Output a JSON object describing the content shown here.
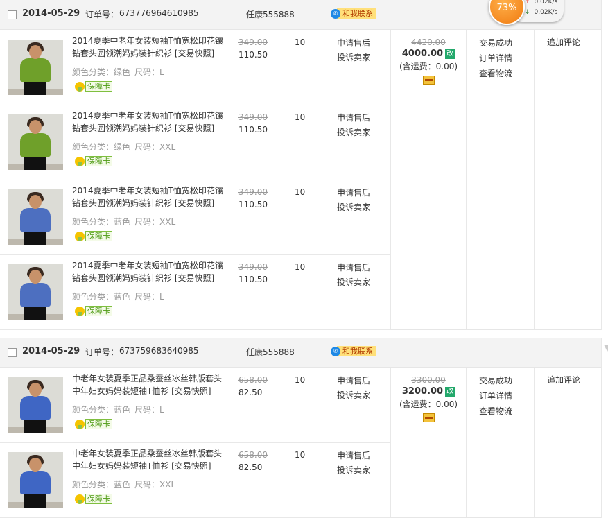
{
  "speed": {
    "percent": "73%",
    "up": "0.02K/s",
    "down": "0.02K/s"
  },
  "orders": [
    {
      "date": "2014-05-29",
      "order_label": "订单号：",
      "order_no": "673776964610985",
      "seller": "任康555888",
      "contact": "和我联系",
      "total_old": "4420.00",
      "total": "4000.00",
      "edit": "改",
      "shipping": "(含运费：0.00)",
      "status": [
        "交易成功",
        "订单详情",
        "查看物流"
      ],
      "review": "追加评论",
      "items": [
        {
          "title": "2014夏季中老年女装短袖T恤宽松印花镶钻套头圆领潮妈妈装针织衫 [交易快照]",
          "attr_color": "颜色分类：绿色",
          "attr_size": "尺码：L",
          "badge": "保障卡",
          "old_price": "349.00",
          "price": "110.50",
          "qty": "10",
          "action1": "申请售后",
          "action2": "投诉卖家",
          "shirt": "#6fa02a"
        },
        {
          "title": "2014夏季中老年女装短袖T恤宽松印花镶钻套头圆领潮妈妈装针织衫 [交易快照]",
          "attr_color": "颜色分类：绿色",
          "attr_size": "尺码：XXL",
          "badge": "保障卡",
          "old_price": "349.00",
          "price": "110.50",
          "qty": "10",
          "action1": "申请售后",
          "action2": "投诉卖家",
          "shirt": "#6fa02a"
        },
        {
          "title": "2014夏季中老年女装短袖T恤宽松印花镶钻套头圆领潮妈妈装针织衫 [交易快照]",
          "attr_color": "颜色分类：蓝色",
          "attr_size": "尺码：XXL",
          "badge": "保障卡",
          "old_price": "349.00",
          "price": "110.50",
          "qty": "10",
          "action1": "申请售后",
          "action2": "投诉卖家",
          "shirt": "#4d6fc0"
        },
        {
          "title": "2014夏季中老年女装短袖T恤宽松印花镶钻套头圆领潮妈妈装针织衫 [交易快照]",
          "attr_color": "颜色分类：蓝色",
          "attr_size": "尺码：L",
          "badge": "保障卡",
          "old_price": "349.00",
          "price": "110.50",
          "qty": "10",
          "action1": "申请售后",
          "action2": "投诉卖家",
          "shirt": "#4d6fc0"
        }
      ]
    },
    {
      "date": "2014-05-29",
      "order_label": "订单号：",
      "order_no": "673759683640985",
      "seller": "任康555888",
      "contact": "和我联系",
      "total_old": "3300.00",
      "total": "3200.00",
      "edit": "改",
      "shipping": "(含运费：0.00)",
      "status": [
        "交易成功",
        "订单详情",
        "查看物流"
      ],
      "review": "追加评论",
      "items": [
        {
          "title": "中老年女装夏季正品桑蚕丝冰丝韩版套头中年妇女妈妈装短袖T恤衫 [交易快照]",
          "attr_color": "颜色分类：蓝色",
          "attr_size": "尺码：L",
          "badge": "保障卡",
          "old_price": "658.00",
          "price": "82.50",
          "qty": "10",
          "action1": "申请售后",
          "action2": "投诉卖家",
          "shirt": "#3f66c4"
        },
        {
          "title": "中老年女装夏季正品桑蚕丝冰丝韩版套头中年妇女妈妈装短袖T恤衫 [交易快照]",
          "attr_color": "颜色分类：蓝色",
          "attr_size": "尺码：XXL",
          "badge": "保障卡",
          "old_price": "658.00",
          "price": "82.50",
          "qty": "10",
          "action1": "申请售后",
          "action2": "投诉卖家",
          "shirt": "#3f66c4"
        }
      ]
    }
  ]
}
